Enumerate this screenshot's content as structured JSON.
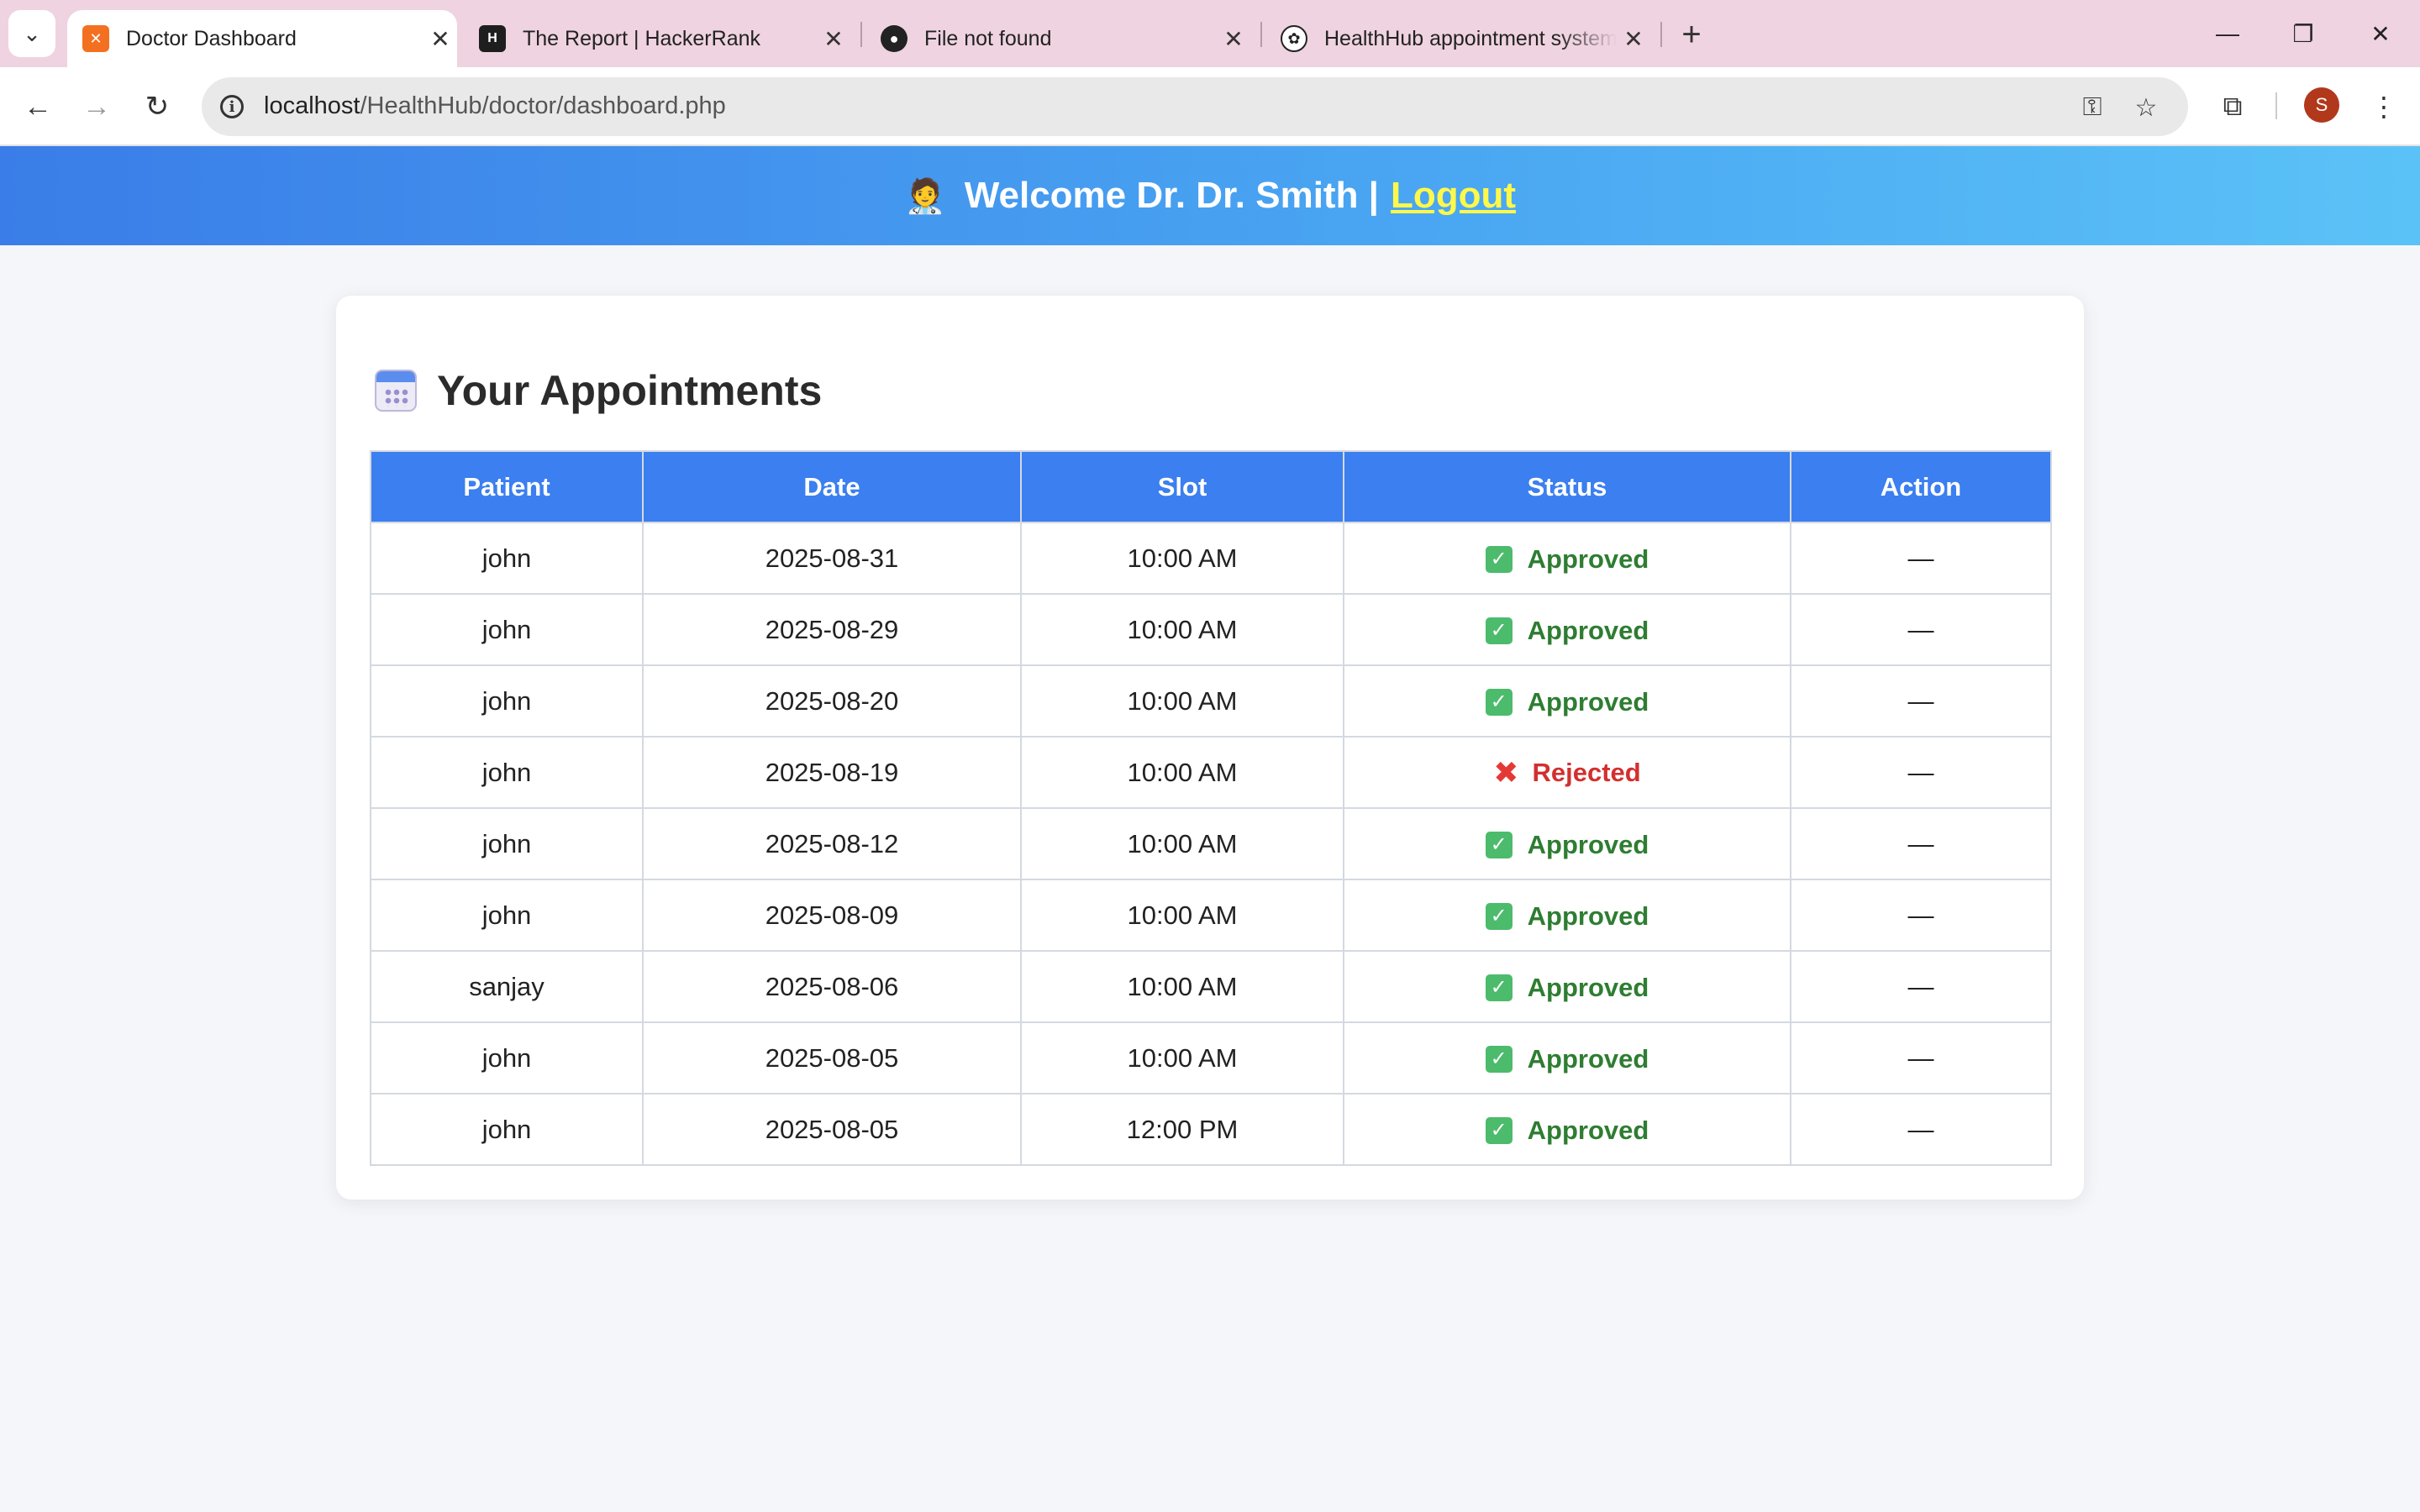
{
  "browser": {
    "tabs": [
      {
        "title": "Doctor Dashboard",
        "favicon": "xampp-icon",
        "favicon_color": "#f37021",
        "active": true
      },
      {
        "title": "The Report | HackerRank",
        "favicon": "hackerrank-icon",
        "favicon_color": "#1e1e1e",
        "active": false
      },
      {
        "title": "File not found",
        "favicon": "github-icon",
        "favicon_color": "#222222",
        "active": false
      },
      {
        "title": "HealthHub appointment system",
        "favicon": "openai-icon",
        "favicon_color": "#222222",
        "active": false
      }
    ],
    "url_host": "localhost",
    "url_path": "/HealthHub/doctor/dashboard.php",
    "profile_initial": "S"
  },
  "header": {
    "emoji": "🧑‍⚕️",
    "welcome_text": "Welcome Dr. Dr. Smith |",
    "logout_label": "Logout"
  },
  "appointments": {
    "title": "Your Appointments",
    "columns": [
      "Patient",
      "Date",
      "Slot",
      "Status",
      "Action"
    ],
    "rows": [
      {
        "patient": "john",
        "date": "2025-08-31",
        "slot": "10:00 AM",
        "status": "Approved",
        "action": "—"
      },
      {
        "patient": "john",
        "date": "2025-08-29",
        "slot": "10:00 AM",
        "status": "Approved",
        "action": "—"
      },
      {
        "patient": "john",
        "date": "2025-08-20",
        "slot": "10:00 AM",
        "status": "Approved",
        "action": "—"
      },
      {
        "patient": "john",
        "date": "2025-08-19",
        "slot": "10:00 AM",
        "status": "Rejected",
        "action": "—"
      },
      {
        "patient": "john",
        "date": "2025-08-12",
        "slot": "10:00 AM",
        "status": "Approved",
        "action": "—"
      },
      {
        "patient": "john",
        "date": "2025-08-09",
        "slot": "10:00 AM",
        "status": "Approved",
        "action": "—"
      },
      {
        "patient": "sanjay",
        "date": "2025-08-06",
        "slot": "10:00 AM",
        "status": "Approved",
        "action": "—"
      },
      {
        "patient": "john",
        "date": "2025-08-05",
        "slot": "10:00 AM",
        "status": "Approved",
        "action": "—"
      },
      {
        "patient": "john",
        "date": "2025-08-05",
        "slot": "12:00 PM",
        "status": "Approved",
        "action": "—"
      }
    ]
  },
  "colors": {
    "header_gradient_start": "#3a7de8",
    "header_gradient_end": "#5bc2f7",
    "table_header": "#3b7ff0",
    "approved": "#2e7d32",
    "rejected": "#d32f2f",
    "logout_link": "#fff84a"
  }
}
